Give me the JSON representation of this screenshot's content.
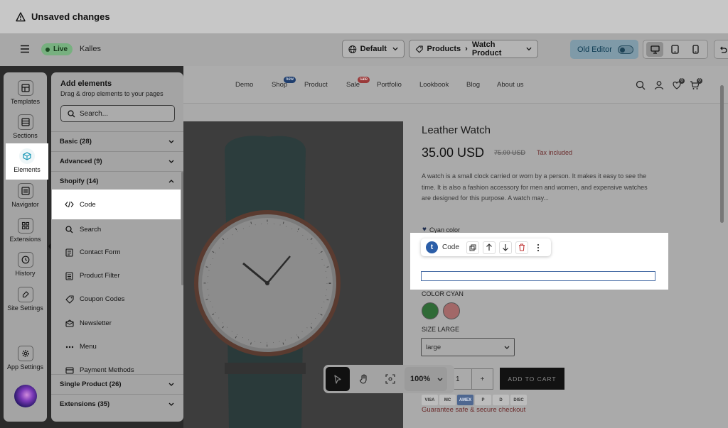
{
  "topbar": {
    "title": "Unsaved changes"
  },
  "header": {
    "live_label": "Live",
    "store_name": "Kalles",
    "theme_select": "Default",
    "page_select": {
      "type": "Products",
      "page": "Watch Product"
    },
    "old_editor_label": "Old Editor"
  },
  "rail": {
    "items": [
      {
        "label": "Templates",
        "icon": "template-icon"
      },
      {
        "label": "Sections",
        "icon": "sections-icon"
      },
      {
        "label": "Elements",
        "icon": "cube-icon"
      },
      {
        "label": "Navigator",
        "icon": "list-icon"
      },
      {
        "label": "Extensions",
        "icon": "extensions-icon"
      },
      {
        "label": "History",
        "icon": "clock-icon"
      },
      {
        "label": "Site Settings",
        "icon": "brush-icon"
      },
      {
        "label": "App Settings",
        "icon": "gear-icon"
      }
    ]
  },
  "panel": {
    "title": "Add elements",
    "subtitle": "Drag & drop elements to your pages",
    "search_placeholder": "Search...",
    "categories": {
      "basic": "Basic (28)",
      "advanced": "Advanced (9)",
      "shopify": "Shopify (14)",
      "single_product": "Single Product (26)",
      "extensions": "Extensions (35)"
    },
    "shopify_items": [
      "Code",
      "Search",
      "Contact Form",
      "Product Filter",
      "Coupon Codes",
      "Newsletter",
      "Menu",
      "Payment Methods"
    ]
  },
  "site": {
    "nav": [
      "Demo",
      "Shop",
      "Product",
      "Sale",
      "Portfolio",
      "Lookbook",
      "Blog",
      "About us"
    ],
    "badges": {
      "shop": "new",
      "sale": "sale"
    },
    "wishlist_count": "0",
    "cart_count": "0",
    "product": {
      "title": "Leather Watch",
      "price": "35.00 USD",
      "old_price": "75.00 USD",
      "tax": "Tax included",
      "description": "A watch is a small clock carried or worn by a person. It makes it easy to see the time. It is also a fashion accessory for men and women, and expensive watches are designed for this purpose. A watch may...",
      "color_line": "Cyan color",
      "color_label": "COLOR CYAN",
      "size_label": "SIZE LARGE",
      "size_value": "large",
      "qty": "1",
      "add_to_cart": "ADD TO CART",
      "payments": [
        "VISA",
        "MC",
        "AMEX",
        "P",
        "D",
        "DISC"
      ],
      "guarantee": "Guarantee safe & secure checkout"
    },
    "swatch_colors": [
      "#2f6a36",
      "#a26868"
    ]
  },
  "element_toolbar": {
    "label": "Code",
    "logo": "t"
  },
  "canvas_toolbar": {
    "zoom": "100%"
  }
}
